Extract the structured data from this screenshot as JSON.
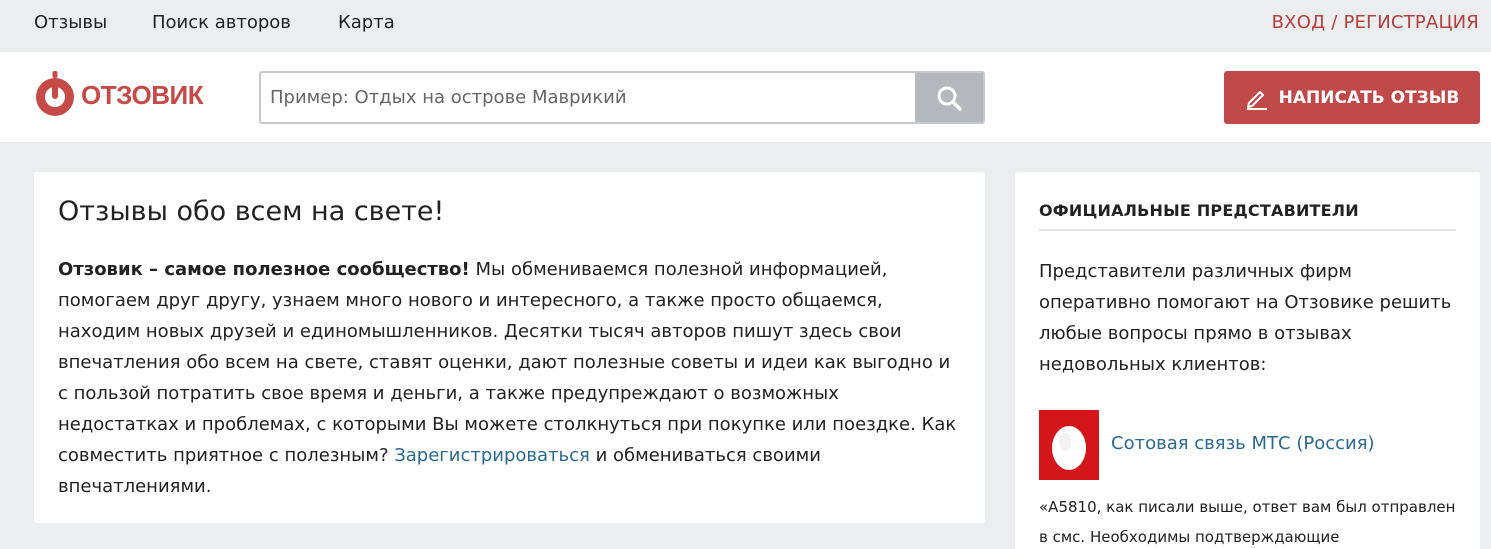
{
  "topnav": {
    "reviews": "Отзывы",
    "find_authors": "Поиск авторов",
    "map": "Карта",
    "login": "ВХОД / РЕГИСТРАЦИЯ"
  },
  "header": {
    "logo_text": "ОТЗОВИК",
    "search_placeholder": "Пример: Отдых на острове Маврикий",
    "search_value": "",
    "write_label": "НАПИСАТЬ ОТЗЫВ",
    "icons": {
      "search": "search-icon",
      "write": "pencil-icon"
    }
  },
  "main": {
    "title": "Отзывы обо всем на свете!",
    "intro_bold": "Отзовик – самое полезное сообщество!",
    "intro_text": " Мы обмениваемся полезной информацией, помогаем друг другу, узнаем много нового и интересного, а также просто общаемся, находим новых друзей и единомышленников. Десятки тысяч авторов пишут здесь свои впечатления обо всем на свете, ставят оценки, дают полезные советы и идеи как выгодно и с пользой потратить свое время и деньги, а также предупреждают о возможных недостатках и проблемах, с которыми Вы можете столкнуться при покупке или поездке. Как совместить приятное с полезным? ",
    "register_link": "Зарегистрироваться",
    "intro_tail": " и обмениваться своими впечатлениями."
  },
  "sidebar": {
    "title": "ОФИЦИАЛЬНЫЕ ПРЕДСТАВИТЕЛИ",
    "intro": "Представители различных фирм оперативно помогают на Отзовике решить любые вопросы прямо в отзывах недовольных клиентов:",
    "rep_name": "Сотовая связь МТС (Россия)",
    "rep_quote": "«A5810, как писали выше, ответ вам был отправлен в смс. Необходимы подтверждающие"
  },
  "colors": {
    "brand_red": "#c0494a",
    "link_blue": "#2a6a91",
    "mts_red": "#d4161b",
    "page_bg": "#ecedef"
  }
}
